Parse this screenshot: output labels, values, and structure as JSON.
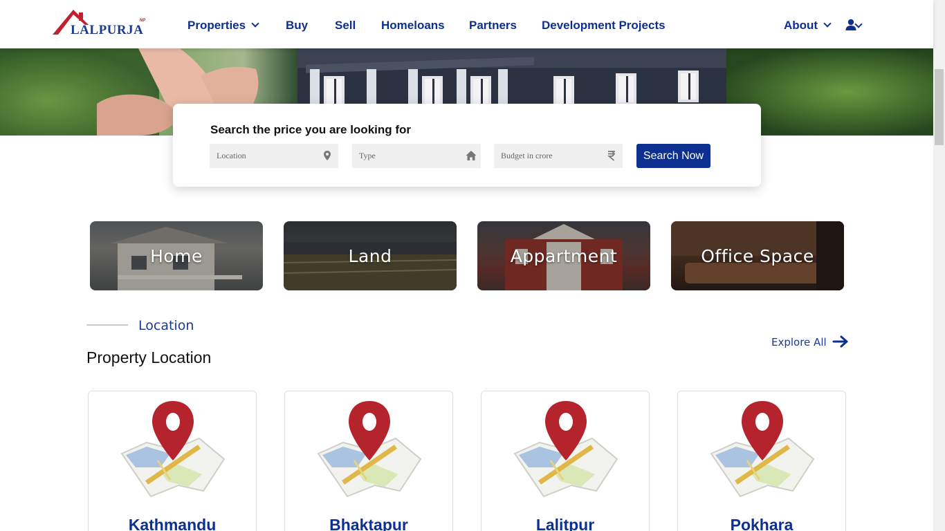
{
  "header": {
    "logo_text": "LALPURJA",
    "logo_tm": "NP",
    "nav": [
      {
        "label": "Properties"
      },
      {
        "label": "Buy"
      },
      {
        "label": "Sell"
      },
      {
        "label": "Homeloans"
      },
      {
        "label": "Partners"
      },
      {
        "label": "Development Projects"
      },
      {
        "label": "About"
      }
    ]
  },
  "search": {
    "title": "Search the price you are looking for",
    "location_placeholder": "Location",
    "type_placeholder": "Type",
    "budget_placeholder": "Budget in crore",
    "button_label": "Search Now"
  },
  "categories": [
    {
      "label": "Home"
    },
    {
      "label": "Land"
    },
    {
      "label": "Appartment"
    },
    {
      "label": "Office Space"
    }
  ],
  "location_section": {
    "subtitle": "Location",
    "title": "Property Location",
    "explore_label": "Explore All",
    "cities": [
      {
        "name": "Kathmandu"
      },
      {
        "name": "Bhaktapur"
      },
      {
        "name": "Lalitpur"
      },
      {
        "name": "Pokhara"
      }
    ]
  },
  "colors": {
    "brand_blue": "#0d2f8f",
    "brand_red": "#c21f2f"
  }
}
